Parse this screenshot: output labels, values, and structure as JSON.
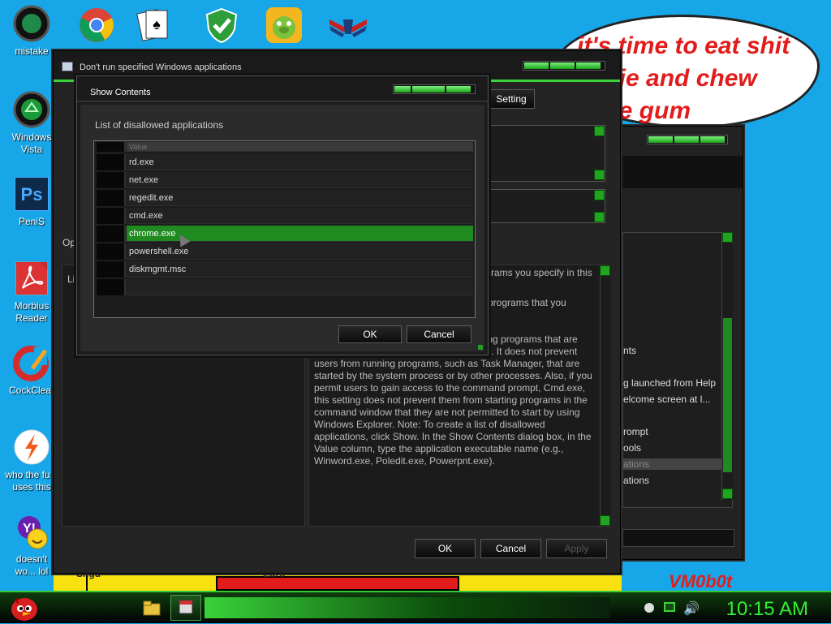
{
  "desktop": {
    "icons": [
      {
        "label": "mistake"
      },
      {
        "label": "Windows Vista"
      },
      {
        "label": "PeniS"
      },
      {
        "label": "Morbius Reader"
      },
      {
        "label": "CockClear"
      },
      {
        "label": "who the fu... uses this"
      },
      {
        "label": "doesn't wo... lol"
      }
    ],
    "bubble_text": "it's time to eat shit\n    die and chew\n   ble gum",
    "watermark": "VM0b0t",
    "bottom_labels": [
      "Shgu",
      "Euro"
    ]
  },
  "policy_window": {
    "title": "Don't run specified Windows applications",
    "setting_button": "Setting",
    "options_label": "Op",
    "list_label": "Lis",
    "help_text": [
      "rams you specify in this",
      "n programs that you",
      "ning programs that are",
      "started by the Windows Explorer process. It does not prevent",
      "users from running programs, such as Task Manager, that are",
      "started by the system process or by other processes. Also, if you",
      "permit users to gain access to the command prompt, Cmd.exe,",
      "this setting does not prevent them from starting programs in the",
      "command window that they are not permitted to start by using",
      "Windows Explorer. Note: To create a list of disallowed",
      "applications, click Show. In the Show Contents dialog box, in the",
      "Value column, type the application executable name (e.g.,",
      "Winword.exe, Poledit.exe, Powerpnt.exe)."
    ],
    "ok_label": "OK",
    "cancel_label": "Cancel",
    "apply_label": "Apply"
  },
  "back_window": {
    "items": [
      "nts",
      "g launched from Help",
      "elcome screen at l...",
      "rompt",
      "ools",
      "ations",
      "ations"
    ]
  },
  "show_contents_dialog": {
    "title": "Show Contents",
    "list_label": "List of disallowed applications",
    "header": "Value",
    "rows": [
      "rd.exe",
      "net.exe",
      "regedit.exe",
      "cmd.exe",
      "chrome.exe",
      "powershell.exe",
      "diskmgmt.msc",
      ""
    ],
    "selected_row": "chrome.exe",
    "ok_label": "OK",
    "cancel_label": "Cancel"
  },
  "taskbar": {
    "clock": "10:15 AM"
  },
  "colors": {
    "accent": "#1f8a1f",
    "desktop": "#17a6e8",
    "clock": "#33ee33"
  }
}
